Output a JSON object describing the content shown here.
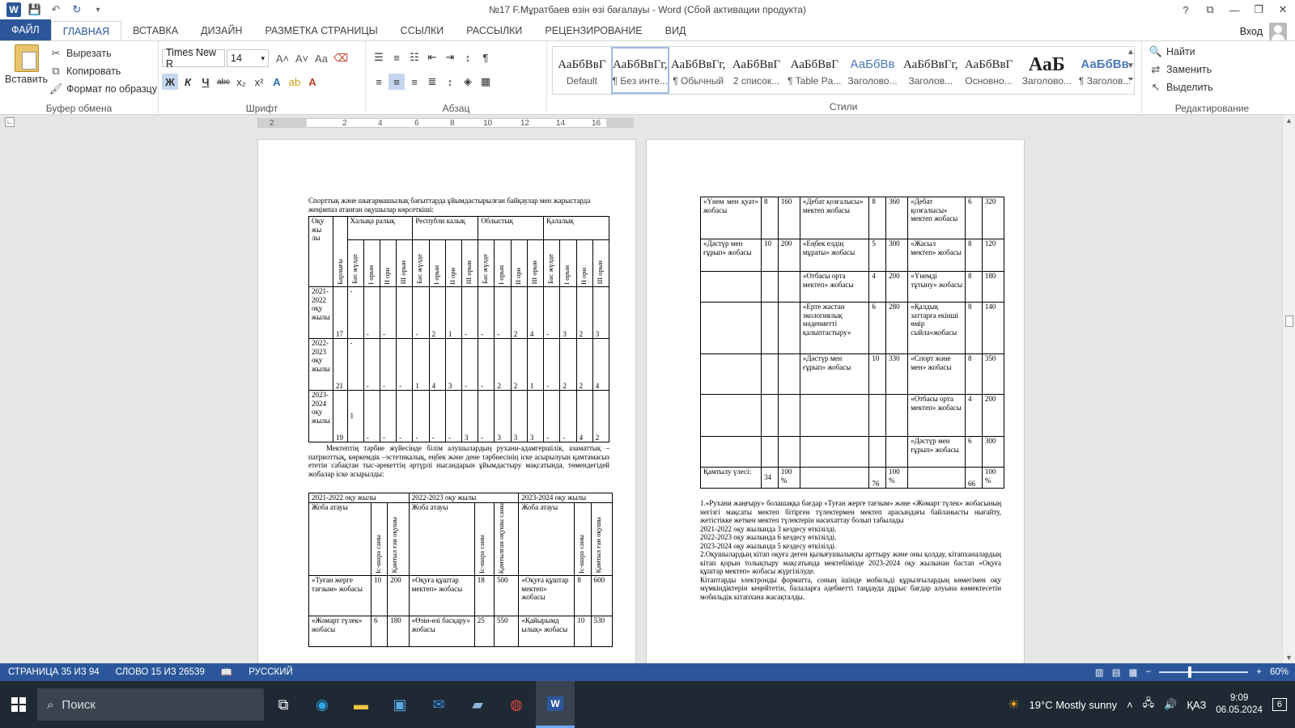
{
  "window": {
    "title": "№17 F.Мұратбаев өзін өзі бағалауы - Word (Сбой активации продукта)",
    "controls": [
      "?",
      "⧉",
      "—",
      "❐",
      "✕"
    ]
  },
  "tabs": [
    "ФАЙЛ",
    "ГЛАВНАЯ",
    "ВСТАВКА",
    "ДИЗАЙН",
    "РАЗМЕТКА СТРАНИЦЫ",
    "ССЫЛКИ",
    "РАССЫЛКИ",
    "РЕЦЕНЗИРОВАНИЕ",
    "ВИД"
  ],
  "signin": "Вход",
  "ribbon": {
    "clipboard": {
      "paste": "Вставить",
      "cut": "Вырезать",
      "copy": "Копировать",
      "painter": "Формат по образцу",
      "label": "Буфер обмена"
    },
    "font": {
      "name": "Times New R",
      "size": "14",
      "label": "Шрифт",
      "bold": "Ж",
      "italic": "К",
      "underline": "Ч",
      "strike": "abc",
      "sub": "x₂",
      "sup": "x²"
    },
    "paragraph": {
      "label": "Абзац"
    },
    "styles": {
      "label": "Стили",
      "items": [
        {
          "preview": "АаБбВвГ",
          "name": "Default"
        },
        {
          "preview": "АаБбВвГг,",
          "name": "¶ Без инте..."
        },
        {
          "preview": "АаБбВвГг,",
          "name": "¶ Обычный"
        },
        {
          "preview": "АаБбВвГ",
          "name": "2 список..."
        },
        {
          "preview": "АаБбВвГ",
          "name": "¶ Table Pa..."
        },
        {
          "preview": "АаБбВв",
          "name": "Заголово..."
        },
        {
          "preview": "АаБбВвГг,",
          "name": "Заголов..."
        },
        {
          "preview": "АаБбВвГ",
          "name": "Основно..."
        },
        {
          "preview": "АаБ",
          "name": "Заголово..."
        },
        {
          "preview": "АаБбВв",
          "name": "¶ Заголов..."
        }
      ]
    },
    "editing": {
      "find": "Найти",
      "replace": "Заменить",
      "select": "Выделить",
      "label": "Редактирование"
    }
  },
  "ruler": [
    "2",
    "2",
    "4",
    "6",
    "8",
    "10",
    "12",
    "14",
    "16"
  ],
  "page1": {
    "heading": "Спорттық және шығармашылық бағыттарда ұйымдастырылған байқаулар мен жарыстарда жеңімпаз атанған оқушылар көрсеткіші:",
    "t1_header": {
      "col1": "Оқу жы лы",
      "count": "Барлығы",
      "groups": [
        "Халықа ралық",
        "Республи калық",
        "Облыстық",
        "Қалалық"
      ],
      "sub": [
        "Бас жүлде",
        "І орын",
        "ІІ орн",
        "ІІІ орын"
      ]
    },
    "t1_rows": [
      {
        "year": "2021-2022 оқу жылы",
        "total": "17",
        "cells": [
          "-",
          "-",
          "-",
          "",
          "-",
          "2",
          "1",
          "-",
          "-",
          "-",
          "2",
          "4",
          "-",
          "3",
          "2",
          "3"
        ]
      },
      {
        "year": "2022-2023 оқу жылы",
        "total": "21",
        "cells": [
          "-",
          "-",
          "-",
          "-",
          "1",
          "4",
          "3",
          "-",
          "-",
          "2",
          "2",
          "1",
          "-",
          "2",
          "2",
          "4"
        ]
      },
      {
        "year": "2023-2024 оқу жылы",
        "total": "19",
        "cells": [
          "1",
          "-",
          "-",
          "-",
          "-",
          "-",
          "-",
          "3",
          "-",
          "3",
          "3",
          "3",
          "-",
          "-",
          "4",
          "2"
        ]
      }
    ],
    "para": "Мектептің тәрбие жүйесінде білім алушылардың рухани-адамгершілік, азаматтық –патриоттық, көркемдік –эстетикалық, еңбек және дене тәрбиесінің іске асырылуын қамтамасыз ететін сабақтан тыс-әрекеттің әртүрлі нысандарын ұйымдастыру мақсатында, төмендегідей жобалар іске асырылды:",
    "t2_years": [
      "2021-2022 оқу жылы",
      "2022-2023 оқу жылы",
      "2023-2024 оқу жылы"
    ],
    "t2_head": {
      "name": "Жоба атауы",
      "events": "Іс-шара саны",
      "covered": "Қамтыл ған оқушы",
      "covered2": "Қамтылған оқушы саны"
    },
    "t2_rows": [
      [
        "«Туған жерге тағзым» жобасы",
        "10",
        "200",
        "«Оқуға құштар мектеп» жобасы",
        "18",
        "500",
        "«Оқуға құштар мектеп» жобасы",
        "8",
        "600"
      ],
      [
        "«Жомарт түлек» жобасы",
        "6",
        "180",
        "«Өзін-өзі басқару» жобасы",
        "25",
        "550",
        "«Қайырымд ылық» жобасы",
        "10",
        "530"
      ]
    ]
  },
  "page2": {
    "t3_rows": [
      [
        "«Үнем мен қуат» жобасы",
        "8",
        "160",
        "«Дебат қозғалысы» мектеп жобасы",
        "8",
        "360",
        "«Дебат қозғалысы» мектеп жобасы",
        "6",
        "320"
      ],
      [
        "«Дәстүр мен ғұрып» жобасы",
        "10",
        "200",
        "«Еңбек елдің мұраты» жобасы",
        "5",
        "300",
        "«Жасыл мектеп» жобасы",
        "8",
        "120"
      ],
      [
        "",
        "",
        "",
        "«Отбасы орта мектеп» жобасы",
        "4",
        "200",
        "«Үнемді тұтыну» жобасы",
        "8",
        "180"
      ],
      [
        "",
        "",
        "",
        "«Ерте жастан экологиялық мәдениетті қалыптастыру»",
        "6",
        "280",
        "«Қалдық заттарға екінші өмір сыйла»жобасы",
        "8",
        "140"
      ],
      [
        "",
        "",
        "",
        "«Дәстүр мен ғұрып» жобасы",
        "10",
        "330",
        "«Спорт және мен» жобасы",
        "8",
        "350"
      ],
      [
        "",
        "",
        "",
        "",
        "",
        "",
        "«Отбасы орта мектеп» жобасы",
        "4",
        "200"
      ],
      [
        "",
        "",
        "",
        "",
        "",
        "",
        "«Дәстүр мен ғұрып» жобасы",
        "6",
        "300"
      ]
    ],
    "t3_total": [
      "Қамтылу үлесі:",
      "34",
      "100 %",
      "",
      "76",
      "100 %",
      "",
      "66",
      "100 %"
    ],
    "notes": [
      "1.«Рухани жаңғыру» болашаққа бағдар «Туған жерге тағзым» және «Жомарт түлек» жобасының негізгі мақсаты мектеп бітірген түлектермен мектеп арасындағы байланысты нығайту, жетістікке жеткен мектеп түлектерін насихаттау болып табылады",
      "2021-2022 оқу жылында 3 кездесу өткізілді.",
      "2022-2023 оқу жылында 6 кездесу өткізілді.",
      "2023-2024 оқу жылында 5 кездесу өткізілді.",
      "2.Оқушылардың кітап оқуға деген қызығушылықты арттыру және оны қолдау, кітапханалардың кітап қорын толықтыру мақсатында мектебімізде 2023-2024 оқу жылынан бастап «Оқуға құштар мектеп» жобасы жүргізілуде.",
      "Кітаптарды электронды форматта, соның ішінде мобильді құрылғылардың көмегімен оқу мүмкіндіктерін кеңейтетін, балаларға әдебиетті таңдауда дұрыс бағдар алуына көмектесетін мобильдік кітапхана жасақталды."
    ]
  },
  "status": {
    "page": "СТРАНИЦА 35 ИЗ 94",
    "words": "СЛОВО 15 ИЗ 26539",
    "lang": "РУССКИЙ",
    "zoom": "60%"
  },
  "taskbar": {
    "search": "Поиск",
    "weather": "19°C Mostly sunny",
    "lang": "ҚАЗ",
    "time": "9:09",
    "date": "06.05.2024",
    "notif": "6"
  }
}
